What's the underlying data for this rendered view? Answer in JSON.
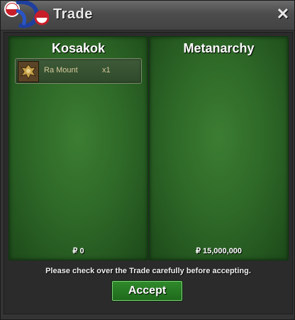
{
  "window": {
    "title": "Trade",
    "close_glyph": "✕"
  },
  "trade": {
    "left": {
      "player": "Kosakok",
      "items": [
        {
          "name": "Ra Mount",
          "qty": "x1",
          "icon": "ra-mount-icon"
        }
      ],
      "money": "₽ 0"
    },
    "right": {
      "player": "Metanarchy",
      "items": [],
      "money": "₽ 15,000,000"
    }
  },
  "notice": "Please check over the Trade carefully before accepting.",
  "accept_label": "Accept",
  "colors": {
    "panel_green": "#2f6a28",
    "accept_green": "#2f8a2a",
    "titlebar": "#4c4c4c"
  }
}
